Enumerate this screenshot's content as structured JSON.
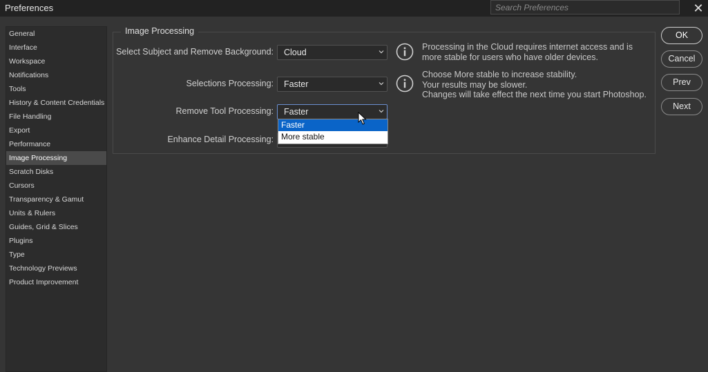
{
  "window": {
    "title": "Preferences",
    "search_placeholder": "Search Preferences",
    "close_glyph": "✕"
  },
  "sidebar": {
    "items": [
      {
        "label": "General"
      },
      {
        "label": "Interface"
      },
      {
        "label": "Workspace"
      },
      {
        "label": "Notifications"
      },
      {
        "label": "Tools"
      },
      {
        "label": "History & Content Credentials"
      },
      {
        "label": "File Handling"
      },
      {
        "label": "Export"
      },
      {
        "label": "Performance"
      },
      {
        "label": "Image Processing"
      },
      {
        "label": "Scratch Disks"
      },
      {
        "label": "Cursors"
      },
      {
        "label": "Transparency & Gamut"
      },
      {
        "label": "Units & Rulers"
      },
      {
        "label": "Guides, Grid & Slices"
      },
      {
        "label": "Plugins"
      },
      {
        "label": "Type"
      },
      {
        "label": "Technology Previews"
      },
      {
        "label": "Product Improvement"
      }
    ],
    "selected_label": "Image Processing"
  },
  "main": {
    "group_title": "Image Processing",
    "rows": [
      {
        "label": "Select Subject and Remove Background:",
        "value": "Cloud"
      },
      {
        "label": "Selections Processing:",
        "value": "Faster"
      },
      {
        "label": "Remove Tool Processing:",
        "value": "Faster"
      },
      {
        "label": "Enhance Detail Processing:",
        "value": ""
      }
    ],
    "info_1": [
      "Processing in the Cloud requires internet access and is",
      "more stable for users who have older devices."
    ],
    "info_2": [
      "Choose More stable to increase stability.",
      "Your results may be slower.",
      "Changes will take effect the next time you start Photoshop."
    ],
    "dropdown": {
      "options": [
        "Faster",
        "More stable"
      ],
      "highlighted": "Faster"
    }
  },
  "buttons": {
    "ok": "OK",
    "cancel": "Cancel",
    "prev": "Prev",
    "next": "Next"
  },
  "colors": {
    "background": "#353535",
    "titlebar": "#222222",
    "sidebar_bg": "#2c2c2c",
    "selected_item": "#4a4a4a",
    "dropdown_highlight": "#0a64c8"
  }
}
